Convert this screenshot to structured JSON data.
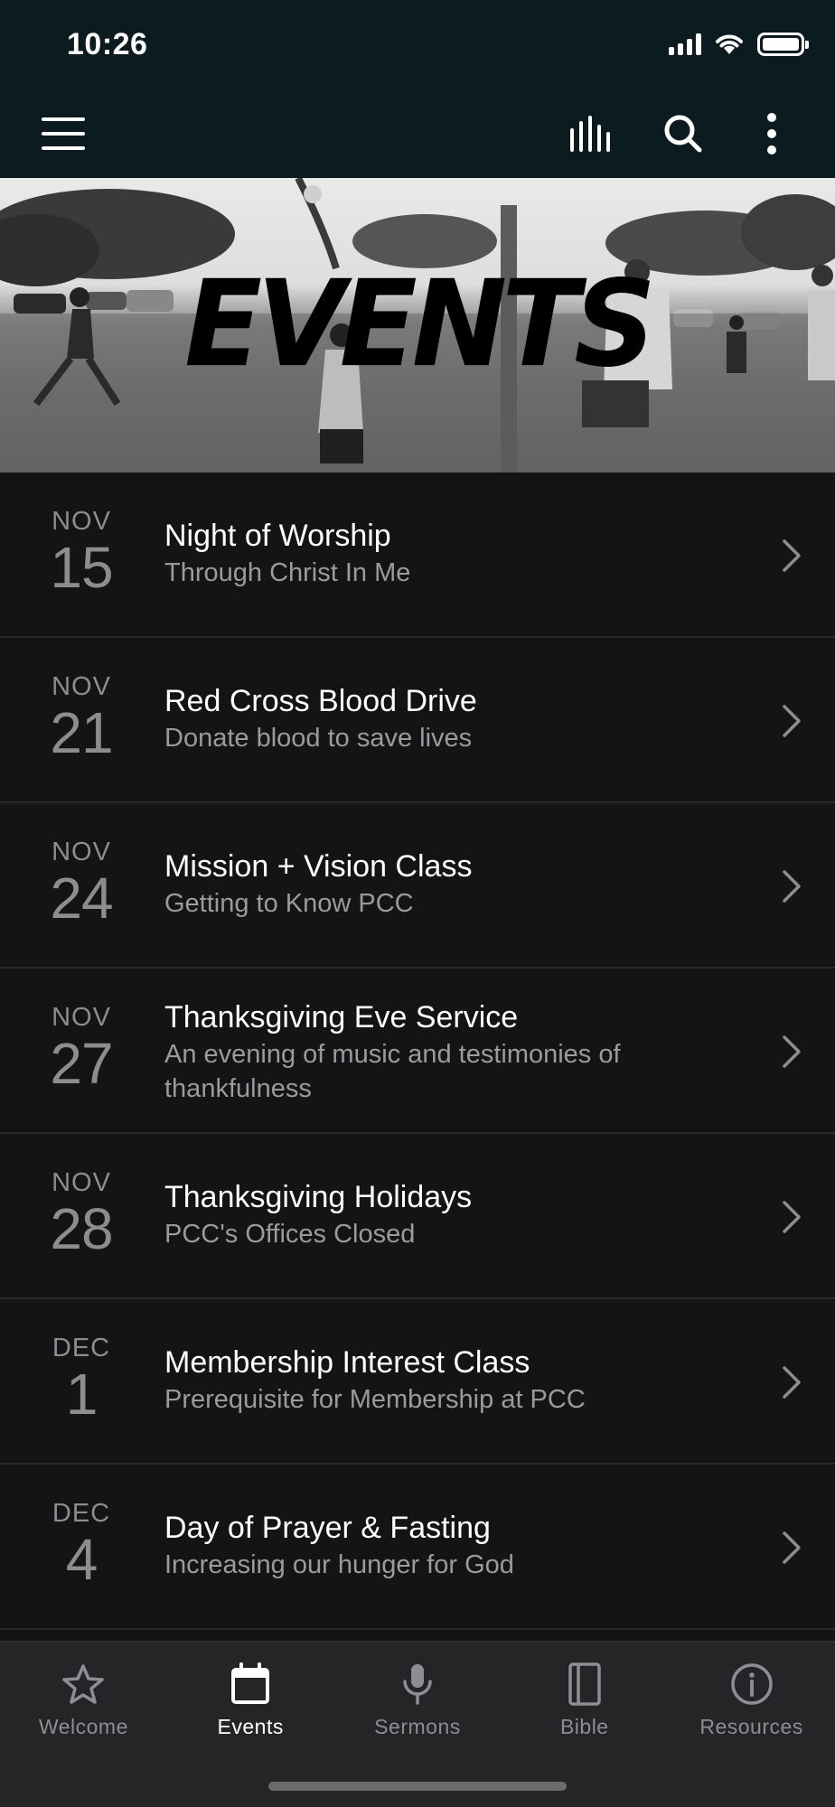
{
  "status_bar": {
    "time": "10:26"
  },
  "app_bar": {
    "icons": [
      "menu-icon",
      "audio-bars-icon",
      "search-icon",
      "more-vertical-icon"
    ]
  },
  "hero": {
    "title": "EVENTS",
    "background": "black-and-white photo of people playing volleyball"
  },
  "events": [
    {
      "month": "NOV",
      "day": "15",
      "title": "Night of Worship",
      "subtitle": "Through Christ In Me"
    },
    {
      "month": "NOV",
      "day": "21",
      "title": "Red Cross Blood Drive",
      "subtitle": "Donate blood to save lives"
    },
    {
      "month": "NOV",
      "day": "24",
      "title": "Mission + Vision Class",
      "subtitle": "Getting to Know PCC"
    },
    {
      "month": "NOV",
      "day": "27",
      "title": "Thanksgiving Eve Service",
      "subtitle": "An evening of music and testimonies of thankfulness"
    },
    {
      "month": "NOV",
      "day": "28",
      "title": "Thanksgiving Holidays",
      "subtitle": "PCC's Offices Closed"
    },
    {
      "month": "DEC",
      "day": "1",
      "title": "Membership Interest Class",
      "subtitle": "Prerequisite for Membership at PCC"
    },
    {
      "month": "DEC",
      "day": "4",
      "title": "Day of Prayer & Fasting",
      "subtitle": "Increasing our hunger for God"
    }
  ],
  "tab_bar": {
    "tabs": [
      {
        "label": "Welcome",
        "icon": "star-icon",
        "active": false
      },
      {
        "label": "Events",
        "icon": "calendar-icon",
        "active": true
      },
      {
        "label": "Sermons",
        "icon": "microphone-icon",
        "active": false
      },
      {
        "label": "Bible",
        "icon": "book-icon",
        "active": false
      },
      {
        "label": "Resources",
        "icon": "info-icon",
        "active": false
      }
    ]
  },
  "colors": {
    "header_bg": "#0b1b20",
    "list_bg": "#141416",
    "tabbar_bg": "#252527",
    "text_primary": "#ffffff",
    "text_secondary": "#9b9b9e",
    "date_text": "#8d8d90"
  }
}
